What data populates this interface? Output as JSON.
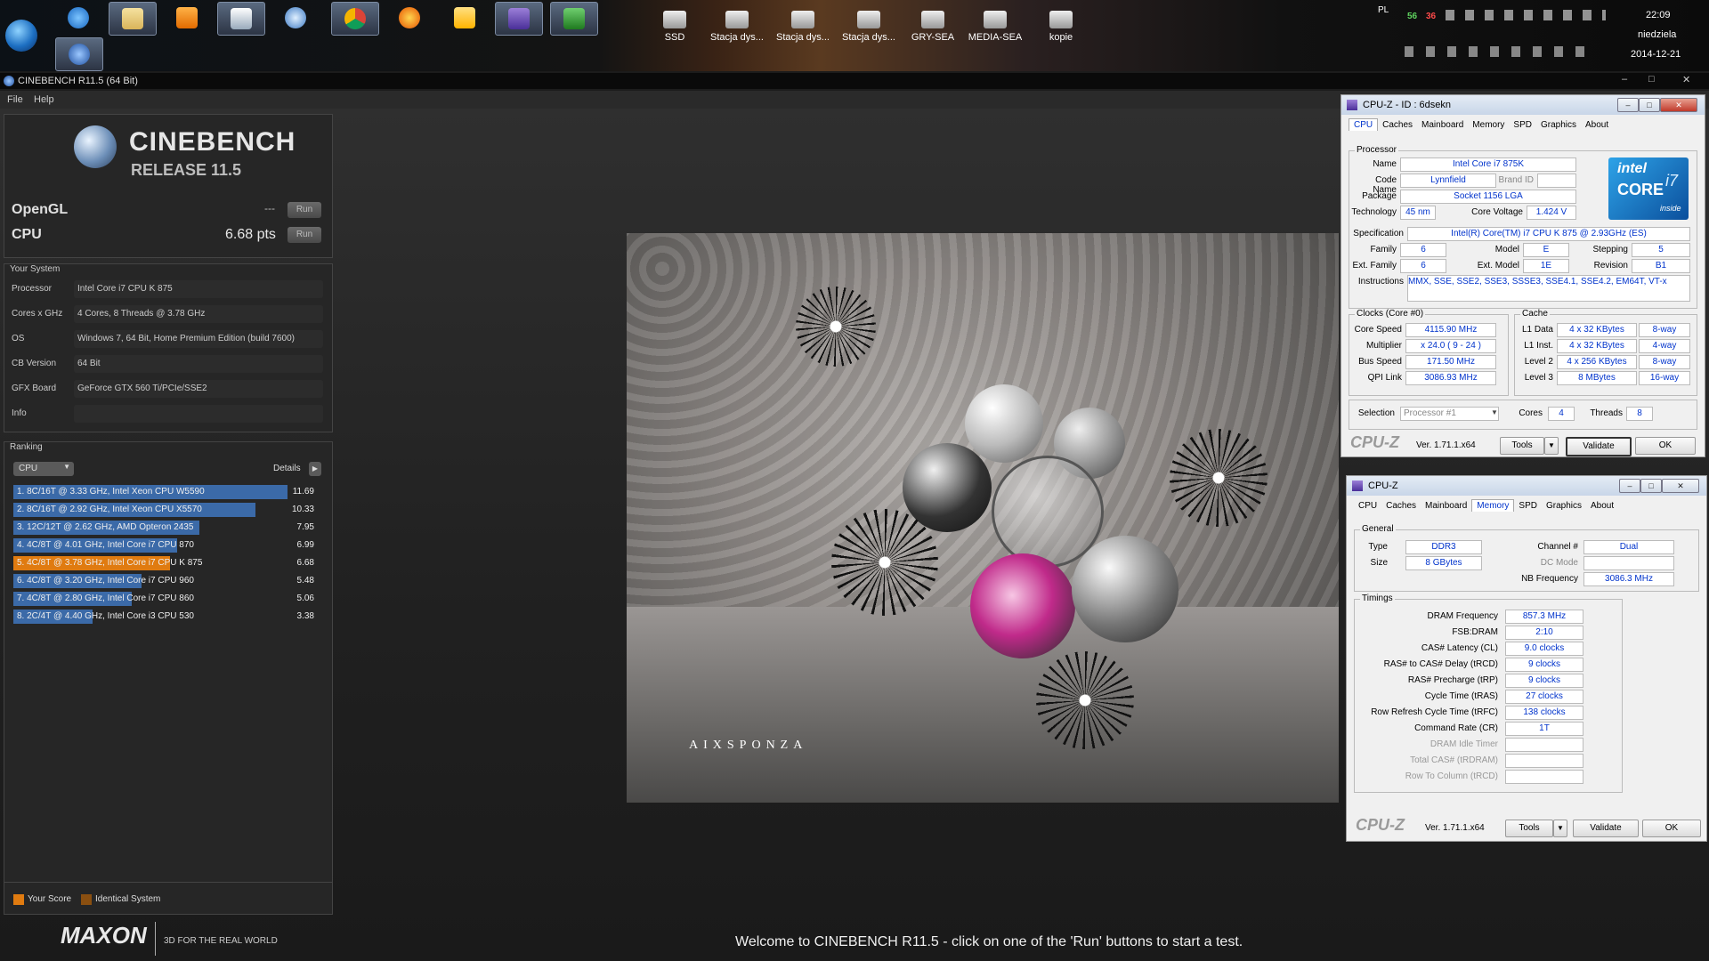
{
  "taskbar": {
    "desktop_icons": [
      {
        "label": "SSD",
        "icon": "windows-drive-icon"
      },
      {
        "label": "Stacja dys...",
        "icon": "bd-drive-icon"
      },
      {
        "label": "Stacja dys...",
        "icon": "drive-icon"
      },
      {
        "label": "Stacja dys...",
        "icon": "dvd-drive-icon"
      },
      {
        "label": "GRY-SEA",
        "icon": "network-drive-icon"
      },
      {
        "label": "MEDIA-SEA",
        "icon": "network-drive-icon"
      },
      {
        "label": "kopie",
        "icon": "network-drive-icon"
      }
    ],
    "tray": {
      "language": "PL",
      "temp1": "56",
      "temp2": "36",
      "time": "22:09",
      "day": "niedziela",
      "date": "2014-12-21"
    }
  },
  "cinebench": {
    "title": "CINEBENCH R11.5 (64 Bit)",
    "menu": [
      "File",
      "Help"
    ],
    "logo_line1": "CINEBENCH",
    "logo_line2": "RELEASE 11.5",
    "opengl_label": "OpenGL",
    "opengl_value": "---",
    "cpu_label": "CPU",
    "cpu_value": "6.68 pts",
    "run_label": "Run",
    "system_title": "Your System",
    "system": [
      {
        "label": "Processor",
        "value": "Intel Core i7 CPU K 875"
      },
      {
        "label": "Cores x GHz",
        "value": "4 Cores, 8 Threads @ 3.78 GHz"
      },
      {
        "label": "OS",
        "value": "Windows 7, 64 Bit, Home Premium Edition (build 7600)"
      },
      {
        "label": "CB Version",
        "value": "64 Bit"
      },
      {
        "label": "GFX Board",
        "value": "GeForce GTX 560 Ti/PCIe/SSE2"
      },
      {
        "label": "Info",
        "value": ""
      }
    ],
    "ranking_title": "Ranking",
    "ranking_select": "CPU",
    "details_label": "Details",
    "ranking": [
      {
        "text": "1. 8C/16T @ 3.33 GHz, Intel Xeon CPU W5590",
        "score": "11.69",
        "fraction": 1.0,
        "mine": false
      },
      {
        "text": "2. 8C/16T @ 2.92 GHz, Intel Xeon CPU X5570",
        "score": "10.33",
        "fraction": 0.884,
        "mine": false
      },
      {
        "text": "3. 12C/12T @ 2.62 GHz, AMD Opteron 2435",
        "score": "7.95",
        "fraction": 0.68,
        "mine": false
      },
      {
        "text": "4. 4C/8T @ 4.01 GHz, Intel Core i7 CPU 870",
        "score": "6.99",
        "fraction": 0.598,
        "mine": false
      },
      {
        "text": "5. 4C/8T @ 3.78 GHz, Intel Core i7 CPU K 875",
        "score": "6.68",
        "fraction": 0.571,
        "mine": true
      },
      {
        "text": "6. 4C/8T @ 3.20 GHz, Intel Core i7 CPU 960",
        "score": "5.48",
        "fraction": 0.469,
        "mine": false
      },
      {
        "text": "7. 4C/8T @ 2.80 GHz, Intel Core i7 CPU 860",
        "score": "5.06",
        "fraction": 0.433,
        "mine": false
      },
      {
        "text": "8. 2C/4T @ 4.40 GHz, Intel Core i3 CPU 530",
        "score": "3.38",
        "fraction": 0.289,
        "mine": false
      }
    ],
    "legend_your_score": "Your Score",
    "legend_identical": "Identical System",
    "maxon": "MAXON",
    "maxon_tagline": "3D FOR THE REAL WORLD",
    "render_watermark": "AIXSPONZA",
    "status": "Welcome to CINEBENCH R11.5 - click on one of the 'Run' buttons to start a test.",
    "colors": {
      "bar": "#3b6aa8",
      "mine": "#e07b10",
      "identical": "#8a4f10"
    }
  },
  "cpuz1": {
    "title": "CPU-Z - ID : 6dsekn",
    "tabs": [
      "CPU",
      "Caches",
      "Mainboard",
      "Memory",
      "SPD",
      "Graphics",
      "About"
    ],
    "selected_tab": "CPU",
    "processor_title": "Processor",
    "name_label": "Name",
    "name": "Intel Core i7 875K",
    "codename_label": "Code Name",
    "codename": "Lynnfield",
    "brandid_label": "Brand ID",
    "package_label": "Package",
    "package": "Socket 1156 LGA",
    "technology_label": "Technology",
    "technology": "45 nm",
    "corevoltage_label": "Core Voltage",
    "corevoltage": "1.424 V",
    "spec_label": "Specification",
    "spec": "Intel(R) Core(TM) i7 CPU      K 875  @ 2.93GHz (ES)",
    "family_label": "Family",
    "family": "6",
    "model_label": "Model",
    "model": "E",
    "stepping_label": "Stepping",
    "stepping": "5",
    "extfamily_label": "Ext. Family",
    "extfamily": "6",
    "extmodel_label": "Ext. Model",
    "extmodel": "1E",
    "revision_label": "Revision",
    "revision": "B1",
    "instructions_label": "Instructions",
    "instructions": "MMX, SSE, SSE2, SSE3, SSSE3, SSE4.1, SSE4.2, EM64T, VT-x",
    "clocks_title": "Clocks (Core #0)",
    "corespeed_label": "Core Speed",
    "corespeed": "4115.90 MHz",
    "multiplier_label": "Multiplier",
    "multiplier": "x 24.0 ( 9 - 24 )",
    "busspeed_label": "Bus Speed",
    "busspeed": "171.50 MHz",
    "qpilink_label": "QPI Link",
    "qpilink": "3086.93 MHz",
    "cache_title": "Cache",
    "l1d_label": "L1 Data",
    "l1d": "4 x 32 KBytes",
    "l1d_way": "8-way",
    "l1i_label": "L1 Inst.",
    "l1i": "4 x 32 KBytes",
    "l1i_way": "4-way",
    "l2_label": "Level 2",
    "l2": "4 x 256 KBytes",
    "l2_way": "8-way",
    "l3_label": "Level 3",
    "l3": "8 MBytes",
    "l3_way": "16-way",
    "selection_label": "Selection",
    "selection": "Processor #1",
    "cores_label": "Cores",
    "cores": "4",
    "threads_label": "Threads",
    "threads": "8",
    "brand": "CPU-Z",
    "version": "Ver. 1.71.1.x64",
    "tools": "Tools",
    "validate": "Validate",
    "ok": "OK",
    "intel_line1": "intel",
    "intel_line2": "CORE",
    "intel_line3": "i7",
    "intel_line4": "inside"
  },
  "cpuz2": {
    "title": "CPU-Z",
    "tabs": [
      "CPU",
      "Caches",
      "Mainboard",
      "Memory",
      "SPD",
      "Graphics",
      "About"
    ],
    "selected_tab": "Memory",
    "general_title": "General",
    "type_label": "Type",
    "type": "DDR3",
    "channel_label": "Channel #",
    "channel": "Dual",
    "size_label": "Size",
    "size": "8 GBytes",
    "dcmode_label": "DC Mode",
    "nbfreq_label": "NB Frequency",
    "nbfreq": "3086.3 MHz",
    "timings_title": "Timings",
    "timings": [
      {
        "label": "DRAM Frequency",
        "value": "857.3 MHz",
        "enabled": true
      },
      {
        "label": "FSB:DRAM",
        "value": "2:10",
        "enabled": true
      },
      {
        "label": "CAS# Latency (CL)",
        "value": "9.0 clocks",
        "enabled": true
      },
      {
        "label": "RAS# to CAS# Delay (tRCD)",
        "value": "9 clocks",
        "enabled": true
      },
      {
        "label": "RAS# Precharge (tRP)",
        "value": "9 clocks",
        "enabled": true
      },
      {
        "label": "Cycle Time (tRAS)",
        "value": "27 clocks",
        "enabled": true
      },
      {
        "label": "Row Refresh Cycle Time (tRFC)",
        "value": "138 clocks",
        "enabled": true
      },
      {
        "label": "Command Rate (CR)",
        "value": "1T",
        "enabled": true
      },
      {
        "label": "DRAM Idle Timer",
        "value": "",
        "enabled": false
      },
      {
        "label": "Total CAS# (tRDRAM)",
        "value": "",
        "enabled": false
      },
      {
        "label": "Row To Column (tRCD)",
        "value": "",
        "enabled": false
      }
    ],
    "brand": "CPU-Z",
    "version": "Ver. 1.71.1.x64",
    "tools": "Tools",
    "validate": "Validate",
    "ok": "OK"
  }
}
